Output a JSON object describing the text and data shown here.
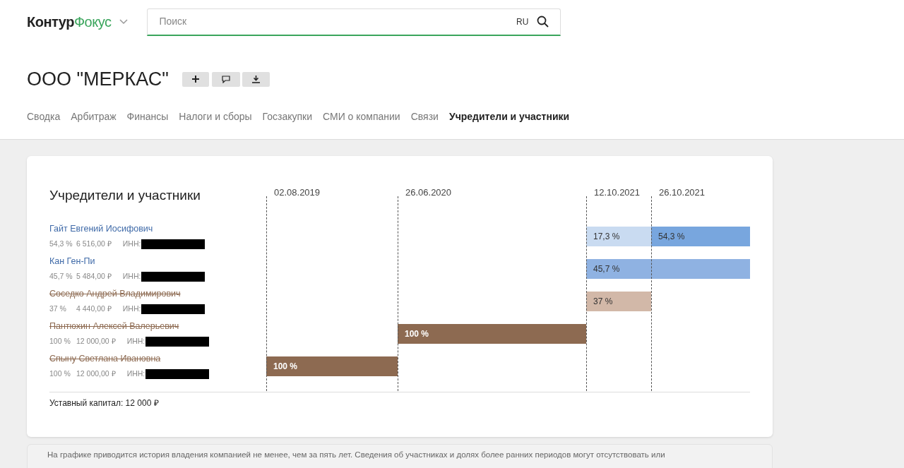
{
  "header": {
    "logo": {
      "part_1": "Контур",
      "part_2": "Фокус"
    },
    "search": {
      "placeholder": "Поиск",
      "language": "RU"
    }
  },
  "company": {
    "title": "ООО \"МЕРКАС\""
  },
  "tabs": [
    {
      "label": "Сводка",
      "selected": false
    },
    {
      "label": "Арбитраж",
      "selected": false
    },
    {
      "label": "Финансы",
      "selected": false
    },
    {
      "label": "Налоги и сборы",
      "selected": false
    },
    {
      "label": "Госзакупки",
      "selected": false
    },
    {
      "label": "СМИ о компании",
      "selected": false
    },
    {
      "label": "Связи",
      "selected": false
    },
    {
      "label": "Учредители и участники",
      "selected": true
    }
  ],
  "founders_card": {
    "title": "Учредители и участники",
    "dates": [
      "02.08.2019",
      "26.06.2020",
      "12.10.2021",
      "26.10.2021"
    ],
    "participants": [
      {
        "name": "Гайт Евгений Иосифович",
        "former": false,
        "share": "54,3 %",
        "amount": "6 516,00 ₽",
        "inn_label": "ИНН:",
        "bars": [
          {
            "label": "17,3 %",
            "color": "#c9dbf1"
          },
          {
            "label": "54,3 %",
            "color": "#78a6de"
          }
        ]
      },
      {
        "name": "Кан Ген-Пи",
        "former": false,
        "share": "45,7 %",
        "amount": "5 484,00 ₽",
        "inn_label": "ИНН:",
        "bars": [
          {
            "label": "45,7 %",
            "color": "#8fb2e2"
          }
        ]
      },
      {
        "name": "Соседко Андрей Владимирович",
        "former": true,
        "share": "37 %",
        "amount": "4 440,00 ₽",
        "inn_label": "ИНН:",
        "bars": [
          {
            "label": "37 %",
            "color": "#d2b8a8"
          }
        ]
      },
      {
        "name": "Пантюхин Алексей Валерьевич",
        "former": true,
        "share": "100 %",
        "amount": "12 000,00 ₽",
        "inn_label": "ИНН:",
        "bars": [
          {
            "label": "100 %",
            "color": "#8d6a51"
          }
        ]
      },
      {
        "name": "Спыну Светлана Ивановна",
        "former": true,
        "share": "100 %",
        "amount": "12 000,00 ₽",
        "inn_label": "ИНН:",
        "bars": [
          {
            "label": "100 %",
            "color": "#8d6a51"
          }
        ]
      }
    ],
    "capital": "Уставный капитал: 12 000 ₽"
  },
  "note": "На графике приводится история владения компанией не менее, чем за пять лет. Сведения об участниках и долях более ранних периодов могут отсутствовать или"
}
